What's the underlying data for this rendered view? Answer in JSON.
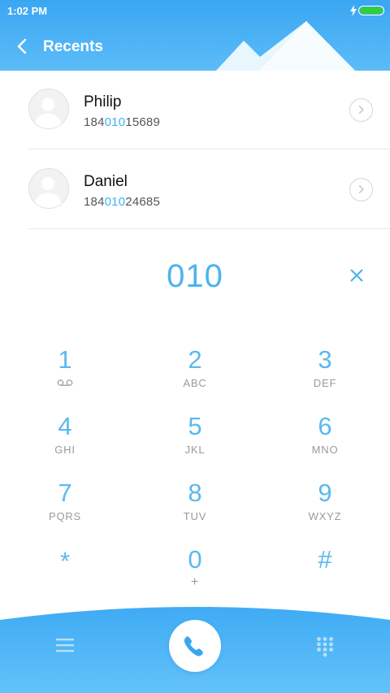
{
  "status_bar": {
    "time": "1:02 PM"
  },
  "header": {
    "title": "Recents"
  },
  "recents": [
    {
      "name": "Philip",
      "number_prefix": "184",
      "number_match": "010",
      "number_suffix": "15689"
    },
    {
      "name": "Daniel",
      "number_prefix": "184",
      "number_match": "010",
      "number_suffix": "24685"
    }
  ],
  "dialer": {
    "input": "010",
    "keys": [
      {
        "digit": "1",
        "sub": ""
      },
      {
        "digit": "2",
        "sub": "ABC"
      },
      {
        "digit": "3",
        "sub": "DEF"
      },
      {
        "digit": "4",
        "sub": "GHI"
      },
      {
        "digit": "5",
        "sub": "JKL"
      },
      {
        "digit": "6",
        "sub": "MNO"
      },
      {
        "digit": "7",
        "sub": "PQRS"
      },
      {
        "digit": "8",
        "sub": "TUV"
      },
      {
        "digit": "9",
        "sub": "WXYZ"
      },
      {
        "digit": "*",
        "sub": ""
      },
      {
        "digit": "0",
        "sub": "+"
      },
      {
        "digit": "#",
        "sub": ""
      }
    ]
  },
  "icons": {
    "back": "back-arrow-icon",
    "clear": "clear-x-icon",
    "voicemail": "voicemail-icon",
    "menu": "menu-icon",
    "call": "phone-icon",
    "keypad": "keypad-grid-icon"
  },
  "colors": {
    "accent": "#4cb3ee",
    "header": "#3aa6f2",
    "battery": "#2fd12f"
  }
}
